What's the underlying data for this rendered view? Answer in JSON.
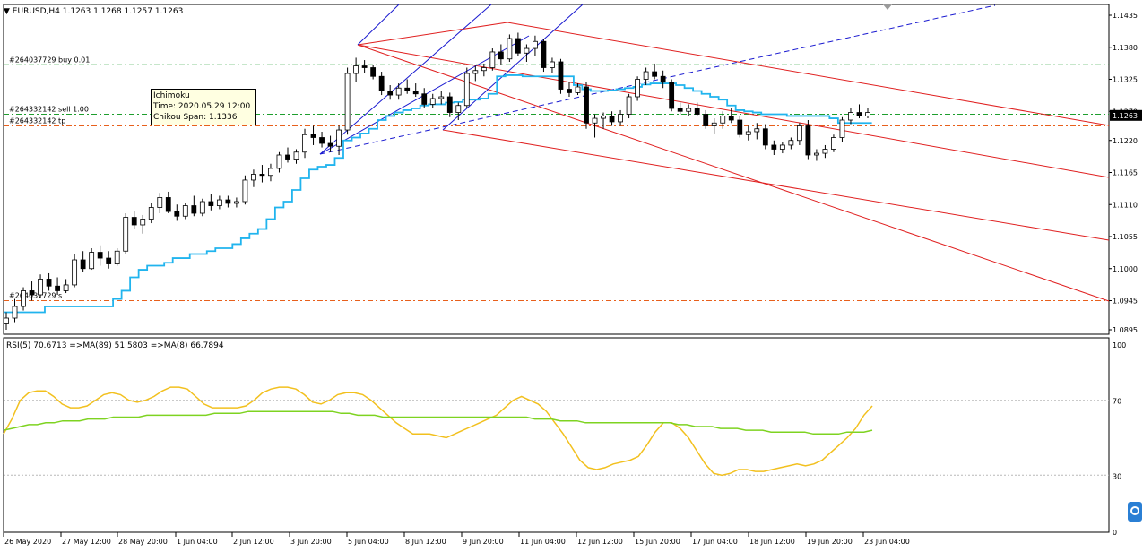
{
  "chart_data": [
    {
      "type": "candlestick",
      "symbol_header": "EURUSD,H4  1.1263 1.1268 1.1257 1.1263",
      "ylim": [
        1.0895,
        1.1435
      ],
      "y_ticks": [
        "1.1435",
        "1.1380",
        "1.1325",
        "1.1270",
        "1.1220",
        "1.1165",
        "1.1110",
        "1.1055",
        "1.1000",
        "1.0945",
        "1.0895"
      ],
      "x_labels": [
        "26 May 2020",
        "27 May 12:00",
        "28 May 20:00",
        "1 Jun 04:00",
        "2 Jun 12:00",
        "3 Jun 20:00",
        "5 Jun 04:00",
        "8 Jun 12:00",
        "9 Jun 20:00",
        "11 Jun 04:00",
        "12 Jun 12:00",
        "15 Jun 20:00",
        "17 Jun 04:00",
        "18 Jun 12:00",
        "19 Jun 20:00",
        "23 Jun 04:00"
      ],
      "price_box": "1.1263",
      "order_lines": [
        {
          "label": "#264037729 buy 0.01",
          "price": 1.135,
          "color": "#1e9e2e"
        },
        {
          "label": "#264332142 sell 1.00",
          "price": 1.1265,
          "color": "#1e9e2e"
        },
        {
          "label": "#264332142 tp",
          "price": 1.1245,
          "color": "#e8601c"
        },
        {
          "label": "#264037729 s",
          "price": 1.0945,
          "color": "#e8601c"
        }
      ],
      "tooltip": {
        "line1": "Ichimoku",
        "line2": "Time: 2020.05.29 12:00",
        "line3": "Chikou Span: 1.1336"
      },
      "candles": [
        [
          1.0905,
          1.0925,
          1.0895,
          1.0915
        ],
        [
          1.0915,
          1.0948,
          1.0908,
          1.0935
        ],
        [
          1.0935,
          1.0968,
          1.0928,
          1.0962
        ],
        [
          1.0962,
          1.0978,
          1.0945,
          1.0955
        ],
        [
          1.0955,
          1.099,
          1.095,
          1.0982
        ],
        [
          1.0982,
          1.0992,
          1.0962,
          1.097
        ],
        [
          1.097,
          1.0985,
          1.0955,
          1.0962
        ],
        [
          1.0962,
          1.0982,
          1.0958,
          1.0972
        ],
        [
          1.0972,
          1.1025,
          1.0968,
          1.1015
        ],
        [
          1.1015,
          1.103,
          1.0995,
          1.1
        ],
        [
          1.1,
          1.1035,
          1.0998,
          1.1028
        ],
        [
          1.1028,
          1.104,
          1.1005,
          1.1018
        ],
        [
          1.1018,
          1.103,
          1.1,
          1.1008
        ],
        [
          1.1008,
          1.1035,
          1.1005,
          1.103
        ],
        [
          1.103,
          1.1095,
          1.1025,
          1.1088
        ],
        [
          1.1088,
          1.1098,
          1.1068,
          1.1075
        ],
        [
          1.1075,
          1.1092,
          1.106,
          1.1085
        ],
        [
          1.1085,
          1.1112,
          1.1078,
          1.1105
        ],
        [
          1.1105,
          1.113,
          1.1095,
          1.1122
        ],
        [
          1.1122,
          1.1132,
          1.1095,
          1.1098
        ],
        [
          1.1098,
          1.111,
          1.1082,
          1.109
        ],
        [
          1.109,
          1.1112,
          1.1085,
          1.1108
        ],
        [
          1.1108,
          1.1125,
          1.109,
          1.1095
        ],
        [
          1.1095,
          1.112,
          1.109,
          1.1115
        ],
        [
          1.1115,
          1.1128,
          1.11,
          1.1108
        ],
        [
          1.1108,
          1.1125,
          1.1102,
          1.1118
        ],
        [
          1.1118,
          1.1125,
          1.1105,
          1.1112
        ],
        [
          1.1112,
          1.1122,
          1.1105,
          1.1115
        ],
        [
          1.1115,
          1.116,
          1.111,
          1.1152
        ],
        [
          1.1152,
          1.117,
          1.114,
          1.1162
        ],
        [
          1.1162,
          1.1178,
          1.1148,
          1.116
        ],
        [
          1.116,
          1.118,
          1.115,
          1.1172
        ],
        [
          1.1172,
          1.12,
          1.1165,
          1.1195
        ],
        [
          1.1195,
          1.1208,
          1.1182,
          1.1188
        ],
        [
          1.1188,
          1.1205,
          1.118,
          1.12
        ],
        [
          1.12,
          1.124,
          1.119,
          1.123
        ],
        [
          1.123,
          1.1245,
          1.1212,
          1.1225
        ],
        [
          1.1225,
          1.1235,
          1.1208,
          1.1215
        ],
        [
          1.1215,
          1.1228,
          1.12,
          1.121
        ],
        [
          1.121,
          1.1245,
          1.1195,
          1.1238
        ],
        [
          1.1238,
          1.1345,
          1.123,
          1.1335
        ],
        [
          1.1335,
          1.1362,
          1.132,
          1.1348
        ],
        [
          1.1348,
          1.1358,
          1.1335,
          1.1345
        ],
        [
          1.1345,
          1.135,
          1.1325,
          1.133
        ],
        [
          1.133,
          1.1338,
          1.1298,
          1.1305
        ],
        [
          1.1305,
          1.1315,
          1.129,
          1.1298
        ],
        [
          1.1298,
          1.1318,
          1.129,
          1.131
        ],
        [
          1.131,
          1.1325,
          1.13,
          1.1305
        ],
        [
          1.1305,
          1.1318,
          1.1295,
          1.13
        ],
        [
          1.13,
          1.131,
          1.1275,
          1.1282
        ],
        [
          1.1282,
          1.13,
          1.1275,
          1.1292
        ],
        [
          1.1292,
          1.1305,
          1.1282,
          1.1295
        ],
        [
          1.1295,
          1.1302,
          1.126,
          1.1268
        ],
        [
          1.1268,
          1.1285,
          1.1255,
          1.128
        ],
        [
          1.128,
          1.1345,
          1.1275,
          1.1335
        ],
        [
          1.1335,
          1.1348,
          1.1322,
          1.134
        ],
        [
          1.134,
          1.1352,
          1.133,
          1.1345
        ],
        [
          1.1345,
          1.1378,
          1.134,
          1.1372
        ],
        [
          1.1372,
          1.1385,
          1.135,
          1.136
        ],
        [
          1.136,
          1.1402,
          1.1355,
          1.1395
        ],
        [
          1.1395,
          1.1405,
          1.1365,
          1.137
        ],
        [
          1.137,
          1.1385,
          1.1355,
          1.1378
        ],
        [
          1.1378,
          1.14,
          1.1365,
          1.139
        ],
        [
          1.139,
          1.1395,
          1.1338,
          1.1345
        ],
        [
          1.1345,
          1.1362,
          1.1335,
          1.1355
        ],
        [
          1.1355,
          1.136,
          1.13,
          1.1308
        ],
        [
          1.1308,
          1.132,
          1.1295,
          1.1302
        ],
        [
          1.1302,
          1.1318,
          1.1298,
          1.1312
        ],
        [
          1.1312,
          1.132,
          1.124,
          1.125
        ],
        [
          1.125,
          1.1265,
          1.1225,
          1.1258
        ],
        [
          1.1258,
          1.1268,
          1.124,
          1.1262
        ],
        [
          1.1262,
          1.127,
          1.1245,
          1.1252
        ],
        [
          1.1252,
          1.1272,
          1.1245,
          1.1265
        ],
        [
          1.1265,
          1.13,
          1.1258,
          1.1295
        ],
        [
          1.1295,
          1.133,
          1.1288,
          1.1325
        ],
        [
          1.1325,
          1.1345,
          1.1315,
          1.1338
        ],
        [
          1.1338,
          1.1352,
          1.1325,
          1.133
        ],
        [
          1.133,
          1.134,
          1.131,
          1.132
        ],
        [
          1.132,
          1.1325,
          1.127,
          1.1275
        ],
        [
          1.1275,
          1.1285,
          1.1265,
          1.127
        ],
        [
          1.127,
          1.1282,
          1.1262,
          1.1275
        ],
        [
          1.1275,
          1.1285,
          1.1262,
          1.1265
        ],
        [
          1.1265,
          1.1272,
          1.124,
          1.1245
        ],
        [
          1.1245,
          1.1258,
          1.1232,
          1.125
        ],
        [
          1.125,
          1.127,
          1.124,
          1.1262
        ],
        [
          1.1262,
          1.1275,
          1.125,
          1.1255
        ],
        [
          1.1255,
          1.1262,
          1.1225,
          1.123
        ],
        [
          1.123,
          1.1245,
          1.122,
          1.1235
        ],
        [
          1.1235,
          1.125,
          1.1222,
          1.124
        ],
        [
          1.124,
          1.1248,
          1.1205,
          1.1212
        ],
        [
          1.1212,
          1.122,
          1.1195,
          1.1205
        ],
        [
          1.1205,
          1.1218,
          1.1198,
          1.1212
        ],
        [
          1.1212,
          1.1225,
          1.1205,
          1.122
        ],
        [
          1.122,
          1.125,
          1.1212,
          1.1245
        ],
        [
          1.1245,
          1.1255,
          1.1188,
          1.1195
        ],
        [
          1.1195,
          1.1205,
          1.1185,
          1.1198
        ],
        [
          1.1198,
          1.1212,
          1.119,
          1.1205
        ],
        [
          1.1205,
          1.123,
          1.12,
          1.1225
        ],
        [
          1.1225,
          1.126,
          1.1218,
          1.1255
        ],
        [
          1.1255,
          1.1275,
          1.1248,
          1.1268
        ],
        [
          1.1268,
          1.1282,
          1.1258,
          1.1262
        ],
        [
          1.1262,
          1.1275,
          1.1258,
          1.1268
        ]
      ],
      "ichimoku_line": [
        1.0925,
        1.0925,
        1.0925,
        1.0925,
        1.0925,
        1.0935,
        1.0935,
        1.0935,
        1.0935,
        1.0935,
        1.0935,
        1.0935,
        1.0935,
        1.0948,
        1.0962,
        1.0985,
        1.0998,
        1.1005,
        1.1005,
        1.101,
        1.1018,
        1.1018,
        1.1025,
        1.1025,
        1.103,
        1.1035,
        1.1035,
        1.1042,
        1.1052,
        1.106,
        1.1068,
        1.1085,
        1.1105,
        1.1115,
        1.1135,
        1.1155,
        1.117,
        1.1175,
        1.1178,
        1.119,
        1.122,
        1.1225,
        1.1232,
        1.124,
        1.1255,
        1.1262,
        1.1268,
        1.1272,
        1.1275,
        1.128,
        1.1282,
        1.1282,
        1.1285,
        1.1286,
        1.129,
        1.129,
        1.1292,
        1.13,
        1.133,
        1.1332,
        1.1332,
        1.133,
        1.133,
        1.133,
        1.133,
        1.133,
        1.133,
        1.1315,
        1.1308,
        1.1305,
        1.1305,
        1.1306,
        1.1308,
        1.131,
        1.1312,
        1.1316,
        1.1318,
        1.1318,
        1.1318,
        1.1315,
        1.131,
        1.1305,
        1.13,
        1.1295,
        1.129,
        1.128,
        1.1272,
        1.127,
        1.1268,
        1.1265,
        1.1265,
        1.1265,
        1.1262,
        1.1262,
        1.1262,
        1.1262,
        1.1262,
        1.1258,
        1.125,
        1.125,
        1.125,
        1.125
      ],
      "channels": {
        "red": "#e02020",
        "blue": "#1a1ad0"
      }
    },
    {
      "type": "line",
      "header": "RSI(5) 70.6713  =>MA(89) 51.5803  =>MA(8) 66.7894",
      "ylim": [
        0,
        100
      ],
      "y_ticks": [
        "100",
        "70",
        "30",
        "0"
      ],
      "levels": [
        70,
        30
      ],
      "series": [
        {
          "color": "#f2c01e",
          "values": [
            52,
            60,
            70,
            74,
            75,
            75,
            72,
            68,
            66,
            66,
            67,
            70,
            73,
            74,
            73,
            70,
            69,
            70,
            72,
            75,
            77,
            77,
            76,
            72,
            68,
            66,
            66,
            66,
            66,
            67,
            70,
            74,
            76,
            77,
            77,
            76,
            73,
            69,
            68,
            70,
            73,
            74,
            74,
            73,
            70,
            66,
            62,
            58,
            55,
            52,
            52,
            52,
            51,
            50,
            52,
            54,
            56,
            58,
            60,
            62,
            66,
            70,
            72,
            70,
            68,
            64,
            58,
            52,
            45,
            38,
            34,
            33,
            34,
            36,
            37,
            38,
            40,
            46,
            53,
            58,
            58,
            55,
            50,
            43,
            36,
            31,
            30,
            31,
            33,
            33,
            32,
            32,
            33,
            34,
            35,
            36,
            35,
            36,
            38,
            42,
            46,
            50,
            55,
            62,
            67
          ]
        },
        {
          "color": "#7ed321",
          "values": [
            54,
            55,
            56,
            57,
            57,
            58,
            58,
            59,
            59,
            59,
            60,
            60,
            60,
            61,
            61,
            61,
            61,
            62,
            62,
            62,
            62,
            62,
            62,
            62,
            62,
            63,
            63,
            63,
            63,
            64,
            64,
            64,
            64,
            64,
            64,
            64,
            64,
            64,
            64,
            64,
            63,
            63,
            62,
            62,
            62,
            61,
            61,
            61,
            61,
            61,
            61,
            61,
            61,
            61,
            61,
            61,
            61,
            61,
            61,
            61,
            61,
            61,
            61,
            60,
            60,
            60,
            59,
            59,
            59,
            58,
            58,
            58,
            58,
            58,
            58,
            58,
            58,
            58,
            58,
            58,
            57,
            57,
            56,
            56,
            56,
            55,
            55,
            55,
            54,
            54,
            54,
            53,
            53,
            53,
            53,
            53,
            52,
            52,
            52,
            52,
            53,
            53,
            53,
            54
          ]
        }
      ]
    }
  ]
}
